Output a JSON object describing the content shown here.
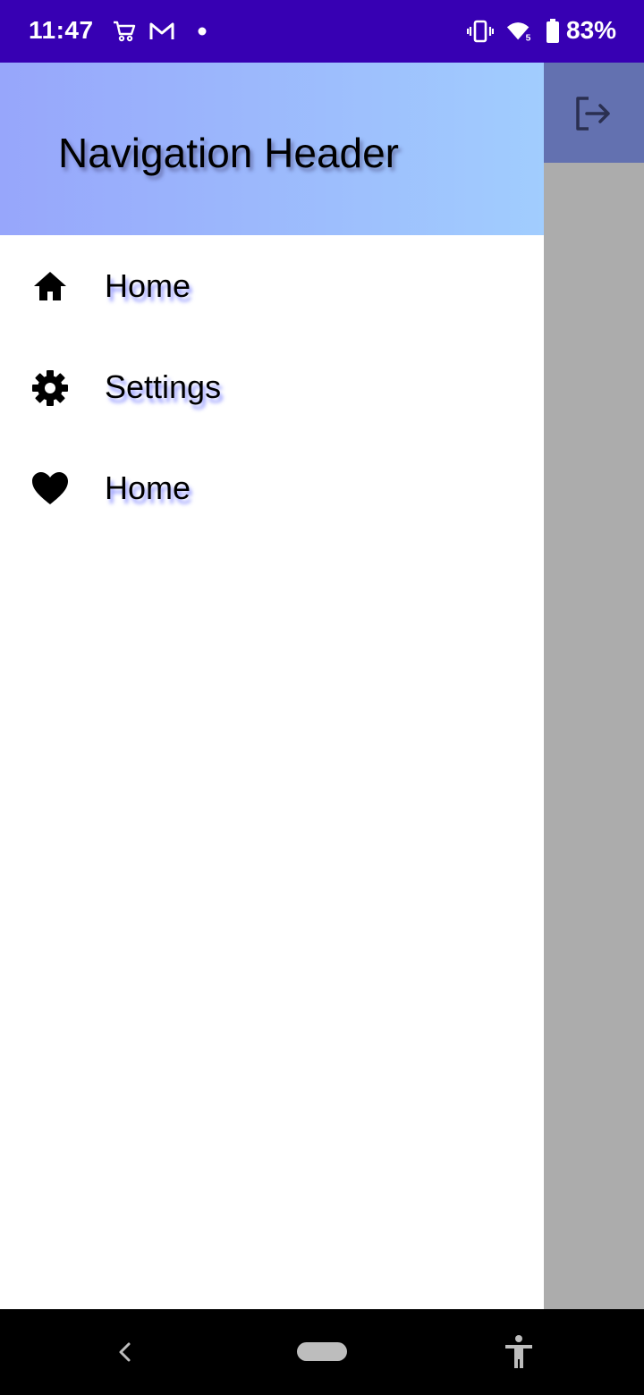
{
  "status_bar": {
    "time": "11:47",
    "battery": "83%",
    "icons": [
      "shopping-cart-icon",
      "gmail-icon",
      "dot-icon",
      "vibrate-icon",
      "wifi-icon",
      "battery-icon"
    ]
  },
  "drawer": {
    "header_title": "Navigation Header",
    "items": [
      {
        "label": "Home",
        "icon": "home-icon"
      },
      {
        "label": "Settings",
        "icon": "gear-icon"
      },
      {
        "label": "Home",
        "icon": "heart-icon"
      }
    ]
  },
  "app": {
    "toolbar_action_icon": "logout-icon"
  },
  "nav_bar": {
    "icons": [
      "back-icon",
      "home-pill-icon",
      "accessibility-icon"
    ]
  },
  "colors": {
    "status_bar": "#3700b3",
    "header_gradient_start": "#97a6fb",
    "header_gradient_end": "#a1cdfe",
    "scrim_toolbar": "#6371b0",
    "scrim_body": "#acacac"
  }
}
